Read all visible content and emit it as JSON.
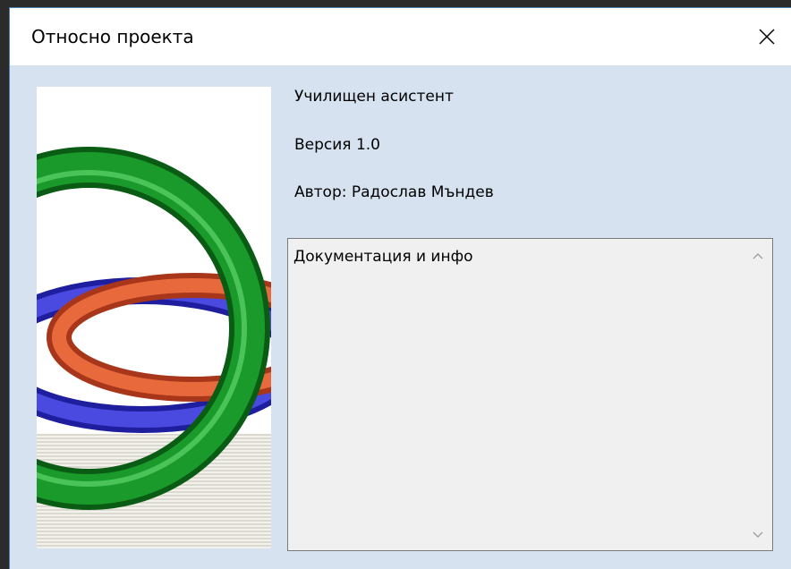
{
  "window": {
    "title": "Относно проекта"
  },
  "info": {
    "app_name": "Училищен асистент",
    "version": "Версия 1.0",
    "author": "Автор: Радослав Мъндев"
  },
  "description": {
    "text": "Документация и инфо"
  },
  "icons": {
    "close": "close-icon",
    "scroll_up": "chevron-up-icon",
    "scroll_down": "chevron-down-icon"
  },
  "colors": {
    "window_bg": "#d6e2ef",
    "ring_green": "#1a9a2a",
    "ring_red": "#d9542a",
    "ring_blue": "#3434c8"
  }
}
